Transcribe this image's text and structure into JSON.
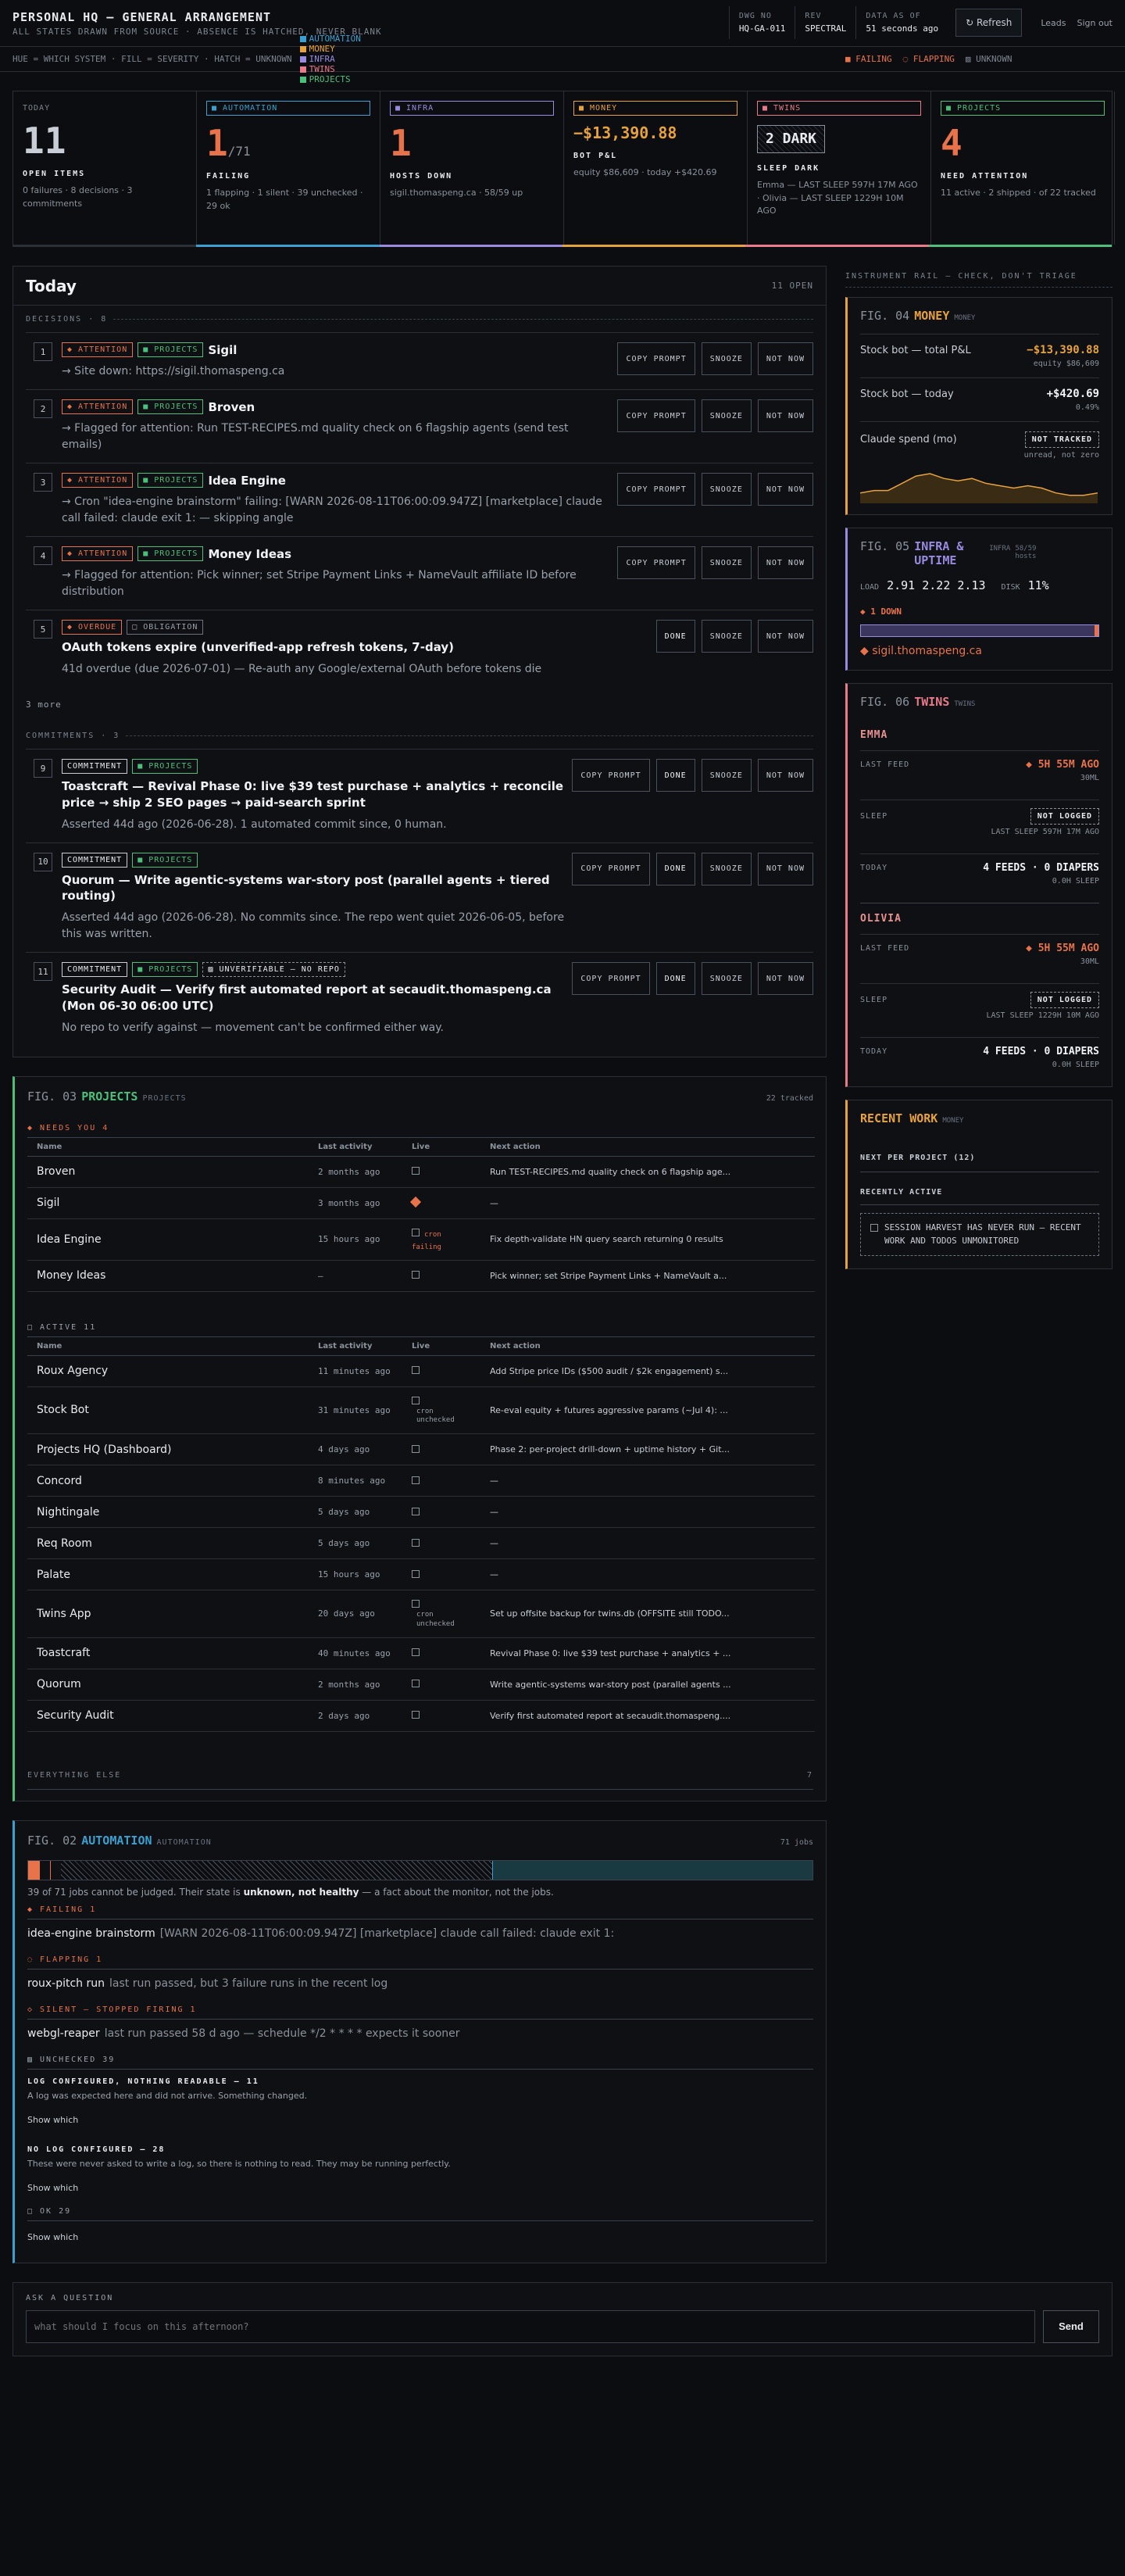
{
  "header": {
    "title": "PERSONAL HQ — GENERAL ARRANGEMENT",
    "subtitle": "ALL STATES DRAWN FROM SOURCE · ABSENCE IS HATCHED, NEVER BLANK",
    "dwg_k": "DWG NO",
    "dwg_v": "HQ-GA-011",
    "rev_k": "REV",
    "rev_v": "SPECTRAL",
    "asof_k": "DATA AS OF",
    "asof_v": "51 seconds ago",
    "refresh": "↻ Refresh",
    "leads": "Leads",
    "signout": "Sign out"
  },
  "legend": {
    "text": "HUE = WHICH SYSTEM · FILL = SEVERITY · HATCH = UNKNOWN",
    "items": [
      {
        "label": "AUTOMATION",
        "color": "#3aa0d0"
      },
      {
        "label": "MONEY",
        "color": "#e8a23c"
      },
      {
        "label": "INFRA",
        "color": "#9a8ae0"
      },
      {
        "label": "TWINS",
        "color": "#e87a8a"
      },
      {
        "label": "PROJECTS",
        "color": "#4ac07a"
      }
    ],
    "failing": "■ FAILING",
    "flapping": "◌ FLAPPING",
    "unknown": "▨ UNKNOWN"
  },
  "tiles": [
    {
      "tag": "TODAY",
      "big": "11",
      "suffix": "",
      "label": "OPEN ITEMS",
      "sub": "0 failures · 8 decisions · 3 commitments",
      "color": "#c9ced6"
    },
    {
      "tag": "■ AUTOMATION",
      "big": "1",
      "suffix": "/71",
      "label": "FAILING",
      "sub": "1 flapping · 1 silent · 39 unchecked · 29 ok",
      "color": "#e8734a",
      "tagcolor": "#3aa0d0"
    },
    {
      "tag": "■ INFRA",
      "big": "1",
      "suffix": "",
      "label": "HOSTS DOWN",
      "sub": "sigil.thomaspeng.ca · 58/59 up",
      "color": "#e8734a",
      "tagcolor": "#9a8ae0"
    },
    {
      "tag": "■ MONEY",
      "big": "−$13,390.88",
      "suffix": "",
      "label": "BOT P&L",
      "sub": "equity $86,609 · today +$420.69",
      "color": "#e8a23c",
      "tagcolor": "#e8a23c"
    },
    {
      "tag": "■ TWINS",
      "big": "2 DARK",
      "suffix": "",
      "label": "SLEEP DARK",
      "sub": "Emma — LAST SLEEP 597H 17M AGO · Olivia — LAST SLEEP 1229H 10M AGO",
      "color": "#e8ebf0",
      "tagcolor": "#e87a8a"
    },
    {
      "tag": "■ PROJECTS",
      "big": "4",
      "suffix": "",
      "label": "NEED ATTENTION",
      "sub": "11 active · 2 shipped · of 22 tracked",
      "color": "#e8734a",
      "tagcolor": "#4ac07a"
    }
  ],
  "today": {
    "title": "Today",
    "open": "11 OPEN",
    "decisions_label": "DECISIONS · 8",
    "commitments_label": "COMMITMENTS · 3",
    "more": "3 more",
    "decisions": [
      {
        "n": "1",
        "chips": [
          "◆ ATTENTION",
          "■ PROJECTS"
        ],
        "title": "Sigil",
        "desc": "→ Site down: https://sigil.thomaspeng.ca",
        "actions": [
          "COPY PROMPT",
          "SNOOZE",
          "NOT NOW"
        ]
      },
      {
        "n": "2",
        "chips": [
          "◆ ATTENTION",
          "■ PROJECTS"
        ],
        "title": "Broven",
        "desc": "→ Flagged for attention: Run TEST-RECIPES.md quality check on 6 flagship agents (send test emails)",
        "actions": [
          "COPY PROMPT",
          "SNOOZE",
          "NOT NOW"
        ]
      },
      {
        "n": "3",
        "chips": [
          "◆ ATTENTION",
          "■ PROJECTS"
        ],
        "title": "Idea Engine",
        "desc": "→ Cron \"idea-engine brainstorm\" failing: [WARN 2026-08-11T06:00:09.947Z] [marketplace] claude call failed: claude exit 1: — skipping angle",
        "actions": [
          "COPY PROMPT",
          "SNOOZE",
          "NOT NOW"
        ]
      },
      {
        "n": "4",
        "chips": [
          "◆ ATTENTION",
          "■ PROJECTS"
        ],
        "title": "Money Ideas",
        "desc": "→ Flagged for attention: Pick winner; set Stripe Payment Links + NameVault affiliate ID before distribution",
        "actions": [
          "COPY PROMPT",
          "SNOOZE",
          "NOT NOW"
        ]
      },
      {
        "n": "5",
        "chips": [
          "◆ OVERDUE",
          "□ OBLIGATION"
        ],
        "title": "OAuth tokens expire (unverified-app refresh tokens, 7-day)",
        "desc": "41d overdue (due 2026-07-01) — Re-auth any Google/external OAuth before tokens die",
        "actions": [
          "DONE",
          "SNOOZE",
          "NOT NOW"
        ]
      }
    ],
    "commitments": [
      {
        "n": "9",
        "chips": [
          "COMMITMENT",
          "■ PROJECTS"
        ],
        "title": "Toastcraft — Revival Phase 0: live $39 test purchase + analytics + reconcile price → ship 2 SEO pages → paid-search sprint",
        "desc": "Asserted 44d ago (2026-06-28). 1 automated commit since, 0 human.",
        "actions": [
          "COPY PROMPT",
          "DONE",
          "SNOOZE",
          "NOT NOW"
        ]
      },
      {
        "n": "10",
        "chips": [
          "COMMITMENT",
          "■ PROJECTS"
        ],
        "title": "Quorum — Write agentic-systems war-story post (parallel agents + tiered routing)",
        "desc": "Asserted 44d ago (2026-06-28). No commits since. The repo went quiet 2026-06-05, before this was written.",
        "actions": [
          "COPY PROMPT",
          "DONE",
          "SNOOZE",
          "NOT NOW"
        ]
      },
      {
        "n": "11",
        "chips": [
          "COMMITMENT",
          "■ PROJECTS",
          "▨ UNVERIFIABLE — NO REPO"
        ],
        "title": "Security Audit — Verify first automated report at secaudit.thomaspeng.ca (Mon 06-30 06:00 UTC)",
        "desc": "No repo to verify against — movement can't be confirmed either way.",
        "actions": [
          "COPY PROMPT",
          "DONE",
          "SNOOZE",
          "NOT NOW"
        ]
      }
    ]
  },
  "projects": {
    "fig": "FIG. 03",
    "title": "PROJECTS",
    "sub": "PROJECTS",
    "tracked": "22 tracked",
    "needs": "◆ NEEDS YOU 4",
    "active": "□ ACTIVE 11",
    "everything": "EVERYTHING ELSE",
    "everything_n": "7",
    "cols": [
      "Name",
      "Last activity",
      "Live",
      "Next action"
    ],
    "needs_rows": [
      {
        "name": "Broven",
        "last": "2 months ago",
        "live": "box",
        "extra": "",
        "next": "Run TEST-RECIPES.md quality check on 6 flagship age..."
      },
      {
        "name": "Sigil",
        "last": "3 months ago",
        "live": "dia",
        "extra": "",
        "next": "—"
      },
      {
        "name": "Idea Engine",
        "last": "15 hours ago",
        "live": "box",
        "extra": "cron failing",
        "next": "Fix depth-validate HN query search returning 0 results"
      },
      {
        "name": "Money Ideas",
        "last": "—",
        "live": "box",
        "extra": "",
        "next": "Pick winner; set Stripe Payment Links + NameVault a..."
      }
    ],
    "active_rows": [
      {
        "name": "Roux Agency",
        "last": "11 minutes ago",
        "live": "box",
        "extra": "",
        "next": "Add Stripe price IDs ($500 audit / $2k engagement) s..."
      },
      {
        "name": "Stock Bot",
        "last": "31 minutes ago",
        "live": "box",
        "extra": "cron unchecked",
        "next": "Re-eval equity + futures aggressive params (~Jul 4): ..."
      },
      {
        "name": "Projects HQ (Dashboard)",
        "last": "4 days ago",
        "live": "box",
        "extra": "",
        "next": "Phase 2: per-project drill-down + uptime history + Git..."
      },
      {
        "name": "Concord",
        "last": "8 minutes ago",
        "live": "box",
        "extra": "",
        "next": "—"
      },
      {
        "name": "Nightingale",
        "last": "5 days ago",
        "live": "box",
        "extra": "",
        "next": "—"
      },
      {
        "name": "Req Room",
        "last": "5 days ago",
        "live": "box",
        "extra": "",
        "next": "—"
      },
      {
        "name": "Palate",
        "last": "15 hours ago",
        "live": "box",
        "extra": "",
        "next": "—"
      },
      {
        "name": "Twins App",
        "last": "20 days ago",
        "live": "box",
        "extra": "cron unchecked",
        "next": "Set up offsite backup for twins.db (OFFSITE still TODO..."
      },
      {
        "name": "Toastcraft",
        "last": "40 minutes ago",
        "live": "box",
        "extra": "",
        "next": "Revival Phase 0: live $39 test purchase + analytics + ..."
      },
      {
        "name": "Quorum",
        "last": "2 months ago",
        "live": "box",
        "extra": "",
        "next": "Write agentic-systems war-story post (parallel agents ..."
      },
      {
        "name": "Security Audit",
        "last": "2 days ago",
        "live": "box",
        "extra": "",
        "next": "Verify first automated report at secaudit.thomaspeng...."
      }
    ]
  },
  "automation": {
    "fig": "FIG. 02",
    "title": "AUTOMATION",
    "sub": "AUTOMATION",
    "jobs": "71 jobs",
    "summary_pre": "39 of 71 jobs cannot be judged. Their state is ",
    "summary_b": "unknown, not healthy",
    "summary_post": " — a fact about the monitor, not the jobs.",
    "failing": "◆ FAILING 1",
    "failing_item": "idea-engine brainstorm",
    "failing_msg": "[WARN 2026-08-11T06:00:09.947Z] [marketplace] claude call failed: claude exit 1:",
    "flapping": "◌ FLAPPING 1",
    "flapping_item": "roux-pitch run",
    "flapping_msg": "last run passed, but 3 failure runs in the recent log",
    "silent": "◇ SILENT — STOPPED FIRING 1",
    "silent_item": "webgl-reaper",
    "silent_msg": "last run passed 58 d ago — schedule */2 * * * * expects it sooner",
    "unchecked": "▨ UNCHECKED 39",
    "lc_h": "LOG CONFIGURED, NOTHING READABLE — 11",
    "lc_p": "A log was expected here and did not arrive. Something changed.",
    "show1": "Show which",
    "nl_h": "NO LOG CONFIGURED — 28",
    "nl_p": "These were never asked to write a log, so there is nothing to read. They may be running perfectly.",
    "show2": "Show which",
    "ok": "□ OK 29",
    "show3": "Show which",
    "bar": {
      "failing": 1,
      "flapping": 1,
      "silent": 1,
      "unchecked": 39,
      "ok": 29,
      "total": 71
    }
  },
  "rail": {
    "header": "INSTRUMENT RAIL — CHECK, DON'T TRIAGE",
    "money": {
      "fig": "FIG. 04",
      "title": "MONEY",
      "sub": "MONEY",
      "k1": "Stock bot — total P&L",
      "v1": "−$13,390.88",
      "s1": "equity $86,609",
      "k2": "Stock bot — today",
      "v2": "+$420.69",
      "s2": "0.49%",
      "k3": "Claude spend (mo)",
      "v3": "NOT TRACKED",
      "s3": "unread, not zero",
      "spark": [
        3,
        4,
        4,
        7,
        10,
        11,
        9,
        8,
        9,
        7,
        6,
        5,
        6,
        5,
        3,
        2,
        2,
        3
      ]
    },
    "infra": {
      "fig": "FIG. 05",
      "title": "INFRA & UPTIME",
      "sub": "INFRA",
      "hosts": "58/59 hosts",
      "load_k": "LOAD",
      "load_v": "2.91 2.22 2.13",
      "disk_k": "DISK",
      "disk_v": "11%",
      "down": "◆ 1 DOWN",
      "down_host": "◆ sigil.thomaspeng.ca"
    },
    "twins": {
      "fig": "FIG. 06",
      "title": "TWINS",
      "sub": "TWINS",
      "people": [
        {
          "name": "EMMA",
          "lf": "◆ 5H 55M AGO",
          "lf_s": "30ML",
          "sleep": "NOT LOGGED",
          "sleep_s": "LAST SLEEP 597H 17M AGO",
          "today": "4 FEEDS · 0 DIAPERS",
          "today_s": "0.0H SLEEP"
        },
        {
          "name": "OLIVIA",
          "lf": "◆ 5H 55M AGO",
          "lf_s": "30ML",
          "sleep": "NOT LOGGED",
          "sleep_s": "LAST SLEEP 1229H 10M AGO",
          "today": "4 FEEDS · 0 DIAPERS",
          "today_s": "0.0H SLEEP"
        }
      ],
      "lf_k": "LAST FEED",
      "sleep_k": "SLEEP",
      "today_k": "TODAY"
    },
    "recent": {
      "title": "RECENT WORK",
      "sub": "MONEY",
      "npp": "NEXT PER PROJECT (12)",
      "ra": "RECENTLY ACTIVE",
      "note": "SESSION HARVEST HAS NEVER RUN — RECENT WORK AND TODOS UNMONITORED"
    }
  },
  "ask": {
    "label": "ASK A QUESTION",
    "placeholder": "what should I focus on this afternoon?",
    "send": "Send"
  }
}
